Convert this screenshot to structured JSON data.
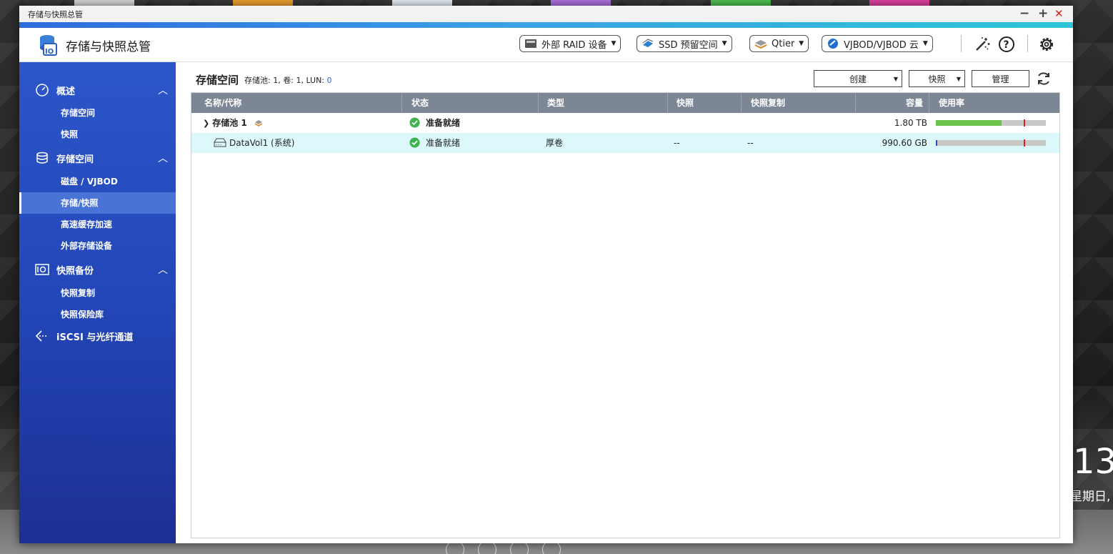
{
  "window": {
    "title": "存储与快照总管",
    "minimize": "−",
    "maximize": "+",
    "close": "✕"
  },
  "header": {
    "app_title": "存储与快照总管",
    "buttons": {
      "raid": "外部 RAID 设备",
      "ssd": "SSD 预留空间",
      "qtier": "Qtier",
      "vjbod": "VJBOD/VJBOD 云"
    }
  },
  "sidebar": {
    "overview": {
      "label": "概述",
      "items": [
        "存储空间",
        "快照"
      ]
    },
    "storage": {
      "label": "存储空间",
      "items": [
        "磁盘 / VJBOD",
        "存储/快照",
        "高速缓存加速",
        "外部存储设备"
      ]
    },
    "snapshot_backup": {
      "label": "快照备份",
      "items": [
        "快照复制",
        "快照保险库"
      ]
    },
    "iscsi": {
      "label": "iSCSI 与光纤通道"
    },
    "active_item": "存储/快照"
  },
  "content": {
    "title": "存储空间",
    "summary": {
      "pool_label": "存储池:",
      "pool_count": "1",
      "vol_label": "卷:",
      "vol_count": "1",
      "lun_label": "LUN:",
      "lun_count": "0"
    },
    "actions": {
      "create": "创建",
      "snapshot": "快照",
      "manage": "管理"
    },
    "table": {
      "columns": [
        "名称/代称",
        "状态",
        "类型",
        "快照",
        "快照复制",
        "容量",
        "使用率"
      ],
      "rows": [
        {
          "name": "存储池 1",
          "status": "准备就绪",
          "type": "",
          "snapshot": "",
          "replication": "",
          "capacity": "1.80 TB",
          "usage_fraction": 0.6
        },
        {
          "name": "DataVol1 (系统)",
          "status": "准备就绪",
          "type": "厚卷",
          "snapshot": "--",
          "replication": "--",
          "capacity": "990.60 GB",
          "usage_fraction": 0.01
        }
      ]
    }
  },
  "desktop": {
    "clock": "13",
    "date": "星期日,"
  },
  "colors": {
    "sidebar": "#2346b8",
    "accent_stripe": "#3aa0e6",
    "table_header": "#7d8694",
    "selected_row": "#dcf8fb",
    "usage_pool": "#6cc24a",
    "usage_vol": "#2a4fd0",
    "threshold": "#e02020",
    "ok": "#3fb34f"
  }
}
